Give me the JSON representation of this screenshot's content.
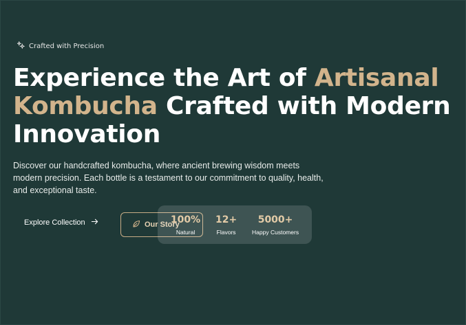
{
  "badge": {
    "icon": "sparkle-icon",
    "text": "Crafted with Precision"
  },
  "headline": {
    "part1": "Experience the Art of ",
    "accent": "Artisanal Kombucha",
    "part2": " Crafted with Modern Innovation"
  },
  "description": "Discover our handcrafted kombucha, where ancient brewing wisdom meets modern precision. Each bottle is a testament to our commitment to quality, health, and exceptional taste.",
  "actions": {
    "explore_label": "Explore Collection",
    "explore_icon": "arrow-right-icon",
    "story_label": "Our Story",
    "story_icon": "leaf-icon"
  },
  "stats": [
    {
      "value": "100%",
      "label": "Natural"
    },
    {
      "value": "12+",
      "label": "Flavors"
    },
    {
      "value": "5000+",
      "label": "Happy Customers"
    }
  ],
  "colors": {
    "background": "#1f3937",
    "accent": "#d2b48c",
    "text": "#ffffff"
  }
}
